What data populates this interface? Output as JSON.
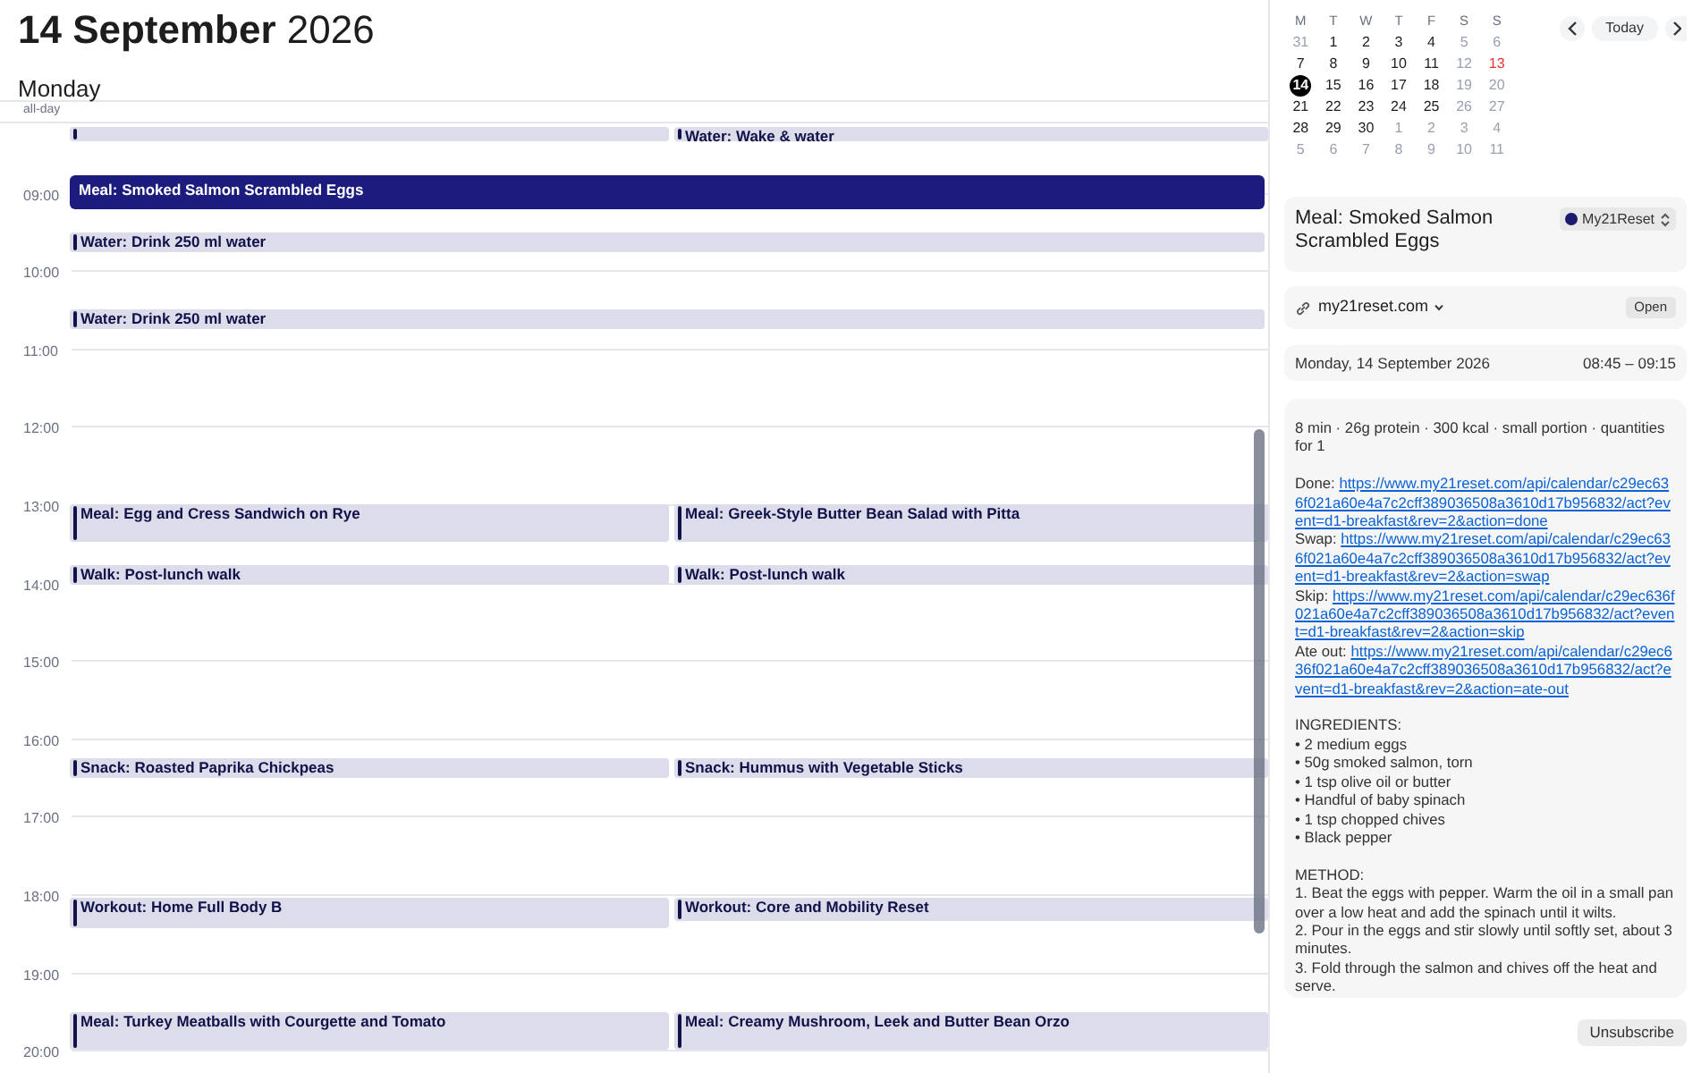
{
  "header": {
    "date_bold": "14 September",
    "year": "2026",
    "weekday": "Monday",
    "all_day_label": "all-day"
  },
  "hours": [
    "09:00",
    "10:00",
    "11:00",
    "12:00",
    "13:00",
    "14:00",
    "15:00",
    "16:00",
    "17:00",
    "18:00",
    "19:00",
    "20:00"
  ],
  "event_rows": [
    {
      "events": [
        {
          "selected": false
        },
        {
          "title": "Water: Wake & water",
          "selected": false
        }
      ]
    },
    {
      "events": [
        {
          "title": "Meal: Smoked Salmon Scrambled Eggs",
          "selected": true
        }
      ]
    },
    {
      "events": [
        {
          "title": "Water: Drink 250 ml water",
          "selected": false
        }
      ]
    },
    {
      "events": [
        {
          "title": "Water: Drink 250 ml water",
          "selected": false
        }
      ]
    },
    {
      "events": [
        {
          "title": "Meal: Egg and Cress Sandwich on Rye",
          "selected": false
        },
        {
          "title": "Meal: Greek-Style Butter Bean Salad with Pitta",
          "selected": false
        }
      ]
    },
    {
      "events": [
        {
          "title": "Walk: Post-lunch walk",
          "selected": false
        },
        {
          "title": "Walk: Post-lunch walk",
          "selected": false
        }
      ]
    },
    {
      "events": [
        {
          "title": "Snack: Roasted Paprika Chickpeas",
          "selected": false
        },
        {
          "title": "Snack: Hummus with Vegetable Sticks",
          "selected": false
        }
      ]
    },
    {
      "events": [
        {
          "title": "Workout: Home Full Body B",
          "selected": false
        },
        {
          "title": "Workout: Core and Mobility Reset",
          "selected": false
        }
      ]
    },
    {
      "events": [
        {
          "title": "Meal: Turkey Meatballs with Courgette and Tomato",
          "selected": false
        },
        {
          "title": "Meal: Creamy Mushroom, Leek and Butter Bean Orzo",
          "selected": false
        }
      ]
    }
  ],
  "mini_calendar": {
    "weekdays": [
      "M",
      "T",
      "W",
      "T",
      "F",
      "S",
      "S"
    ],
    "days": [
      {
        "label": "31",
        "kind": "other",
        "selected": false
      },
      {
        "label": "1",
        "kind": "weekday",
        "selected": false
      },
      {
        "label": "2",
        "kind": "weekday",
        "selected": false
      },
      {
        "label": "3",
        "kind": "weekday",
        "selected": false
      },
      {
        "label": "4",
        "kind": "weekday",
        "selected": false
      },
      {
        "label": "5",
        "kind": "weekend",
        "selected": false
      },
      {
        "label": "6",
        "kind": "weekend",
        "selected": false
      },
      {
        "label": "7",
        "kind": "weekday",
        "selected": false
      },
      {
        "label": "8",
        "kind": "weekday",
        "selected": false
      },
      {
        "label": "9",
        "kind": "weekday",
        "selected": false
      },
      {
        "label": "10",
        "kind": "weekday",
        "selected": false
      },
      {
        "label": "11",
        "kind": "weekday",
        "selected": false
      },
      {
        "label": "12",
        "kind": "weekend",
        "selected": false
      },
      {
        "label": "13",
        "kind": "holiday",
        "selected": false
      },
      {
        "label": "14",
        "kind": "weekday",
        "selected": true
      },
      {
        "label": "15",
        "kind": "weekday",
        "selected": false
      },
      {
        "label": "16",
        "kind": "weekday",
        "selected": false
      },
      {
        "label": "17",
        "kind": "weekday",
        "selected": false
      },
      {
        "label": "18",
        "kind": "weekday",
        "selected": false
      },
      {
        "label": "19",
        "kind": "weekend",
        "selected": false
      },
      {
        "label": "20",
        "kind": "weekend",
        "selected": false
      },
      {
        "label": "21",
        "kind": "weekday",
        "selected": false
      },
      {
        "label": "22",
        "kind": "weekday",
        "selected": false
      },
      {
        "label": "23",
        "kind": "weekday",
        "selected": false
      },
      {
        "label": "24",
        "kind": "weekday",
        "selected": false
      },
      {
        "label": "25",
        "kind": "weekday",
        "selected": false
      },
      {
        "label": "26",
        "kind": "weekend",
        "selected": false
      },
      {
        "label": "27",
        "kind": "weekend",
        "selected": false
      },
      {
        "label": "28",
        "kind": "weekday",
        "selected": false
      },
      {
        "label": "29",
        "kind": "weekday",
        "selected": false
      },
      {
        "label": "30",
        "kind": "weekday",
        "selected": false
      },
      {
        "label": "1",
        "kind": "other",
        "selected": false
      },
      {
        "label": "2",
        "kind": "other",
        "selected": false
      },
      {
        "label": "3",
        "kind": "other",
        "selected": false
      },
      {
        "label": "4",
        "kind": "other",
        "selected": false
      },
      {
        "label": "5",
        "kind": "other",
        "selected": false
      },
      {
        "label": "6",
        "kind": "other",
        "selected": false
      },
      {
        "label": "7",
        "kind": "other",
        "selected": false
      },
      {
        "label": "8",
        "kind": "other",
        "selected": false
      },
      {
        "label": "9",
        "kind": "other",
        "selected": false
      },
      {
        "label": "10",
        "kind": "other",
        "selected": false
      },
      {
        "label": "11",
        "kind": "other",
        "selected": false
      }
    ]
  },
  "nav": {
    "today_button": "Today"
  },
  "detail": {
    "title": "Meal: Smoked Salmon Scrambled Eggs",
    "calendar": {
      "name": "My21Reset",
      "color": "#1a1a6e"
    },
    "link": {
      "label": "my21reset.com",
      "open_button": "Open"
    },
    "date": "Monday, 14 September 2026",
    "time": "08:45 – 09:15",
    "notes": {
      "summary": "8 min · 26g protein · 300 kcal · small portion · quantities for 1",
      "actions": [
        {
          "label": "Done:",
          "url": "https://www.my21reset.com/api/calendar/c29ec636f021a60e4a7c2cff389036508a3610d17b956832/act?event=d1-breakfast&rev=2&action=done"
        },
        {
          "label": "Swap:",
          "url": "https://www.my21reset.com/api/calendar/c29ec636f021a60e4a7c2cff389036508a3610d17b956832/act?event=d1-breakfast&rev=2&action=swap"
        },
        {
          "label": "Skip:",
          "url": "https://www.my21reset.com/api/calendar/c29ec636f021a60e4a7c2cff389036508a3610d17b956832/act?event=d1-breakfast&rev=2&action=skip"
        },
        {
          "label": "Ate out:",
          "url": "https://www.my21reset.com/api/calendar/c29ec636f021a60e4a7c2cff389036508a3610d17b956832/act?event=d1-breakfast&rev=2&action=ate-out"
        }
      ],
      "ingredients_heading": "INGREDIENTS:",
      "ingredients": [
        "• 2 medium eggs",
        "• 50g smoked salmon, torn",
        "• 1 tsp olive oil or butter",
        "• Handful of baby spinach",
        "• 1 tsp chopped chives",
        "• Black pepper"
      ],
      "method_heading": "METHOD:",
      "method": [
        "1. Beat the eggs with pepper. Warm the oil in a small pan over a low heat and add the spinach until it wilts.",
        "2. Pour in the eggs and stir slowly until softly set, about 3 minutes.",
        "3. Fold through the salmon and chives off the heat and serve."
      ]
    }
  },
  "unsubscribe_button": "Unsubscribe"
}
